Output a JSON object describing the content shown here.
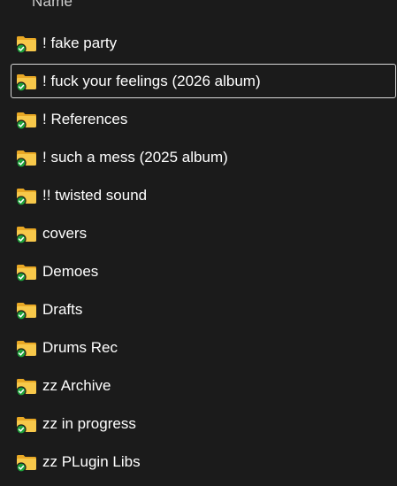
{
  "header": {
    "name_label": "Name"
  },
  "colors": {
    "background": "#1b1b1b",
    "folder_back": "#e8a825",
    "folder_front": "#f7c84a",
    "sync_badge": "#1fa23b"
  },
  "folders": [
    {
      "label": "! fake party",
      "icon": "folder-icon",
      "status": "synced"
    },
    {
      "label": "! fuck your feelings (2026 album)",
      "icon": "folder-icon",
      "status": "synced",
      "focused": true
    },
    {
      "label": "! References",
      "icon": "folder-icon",
      "status": "synced"
    },
    {
      "label": "! such a mess (2025 album)",
      "icon": "folder-icon",
      "status": "synced"
    },
    {
      "label": "!! twisted sound",
      "icon": "folder-icon",
      "status": "synced"
    },
    {
      "label": "covers",
      "icon": "folder-icon",
      "status": "synced"
    },
    {
      "label": "Demoes",
      "icon": "folder-icon",
      "status": "synced"
    },
    {
      "label": "Drafts",
      "icon": "folder-icon",
      "status": "synced"
    },
    {
      "label": "Drums Rec",
      "icon": "folder-icon",
      "status": "synced"
    },
    {
      "label": "zz Archive",
      "icon": "folder-icon",
      "status": "synced"
    },
    {
      "label": "zz in progress",
      "icon": "folder-icon",
      "status": "synced"
    },
    {
      "label": "zz PLugin Libs",
      "icon": "folder-icon",
      "status": "synced"
    }
  ]
}
